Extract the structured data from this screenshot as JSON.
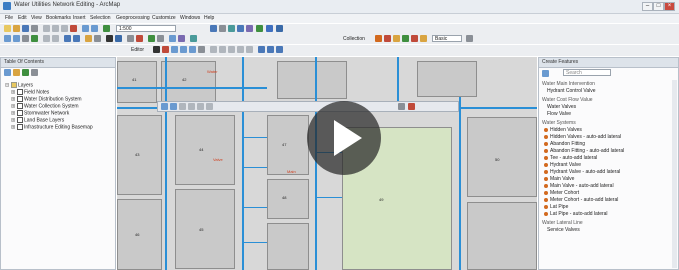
{
  "window": {
    "title": "Water Utilities Network Editing - ArcMap",
    "min_label": "–",
    "max_label": "□",
    "close_label": "×"
  },
  "menu": [
    "File",
    "Edit",
    "View",
    "Bookmarks",
    "Insert",
    "Selection",
    "Geoprocessing",
    "Customize",
    "Windows",
    "Help"
  ],
  "toolbar": {
    "scale": "1:500",
    "editor_label": "Editor",
    "collection_label": "Collection",
    "extent_label": "Basic"
  },
  "toc": {
    "header": "Table Of Contents",
    "items": [
      {
        "label": "Layers",
        "checked": true
      },
      {
        "label": "Field Notes",
        "checked": true
      },
      {
        "label": "Water Distribution System",
        "checked": true
      },
      {
        "label": "Water Collection System",
        "checked": true
      },
      {
        "label": "Stormwater Network",
        "checked": true
      },
      {
        "label": "Land Base Layers",
        "checked": true
      },
      {
        "label": "Infrastructure Editing Basemap",
        "checked": true
      }
    ]
  },
  "create_features": {
    "header": "Create Features",
    "search_placeholder": "Search",
    "groups": [
      {
        "label": "Water Main Intervention",
        "items": [
          "Hydrant Control Valve"
        ]
      },
      {
        "label": "Water Cost Flow Value",
        "items": [
          "Water Valves",
          "Flow Valve"
        ]
      },
      {
        "label": "Water Systems",
        "items": [
          "Hidden Valves",
          "Hidden Valves - auto-add lateral",
          "Abandon Fitting",
          "Abandon Fitting - auto-add lateral",
          "Tee - auto-add lateral",
          "Hydrant Valve",
          "Hydrant Valve - auto-add lateral",
          "Main Valve",
          "Main Valve - auto-add lateral",
          "Meter Cohort",
          "Meter Cohort - auto-add lateral",
          "Lat Pipe",
          "Lat Pipe - auto-add lateral"
        ]
      },
      {
        "label": "Water Lateral Line",
        "items": [
          "Service Valves"
        ]
      }
    ]
  },
  "map": {
    "parcel_labels": [
      "41",
      "42",
      "43",
      "44",
      "45",
      "46",
      "47",
      "48",
      "49",
      "50"
    ],
    "annotation_labels": [
      "Water",
      "Main",
      "Valve"
    ],
    "colors": {
      "pipe": "#2a8fd6",
      "parcel": "#c9c9c9",
      "open_space": "#d6e4c4",
      "annotation": "#d04020"
    }
  },
  "video": {
    "play_icon": "play-icon"
  }
}
